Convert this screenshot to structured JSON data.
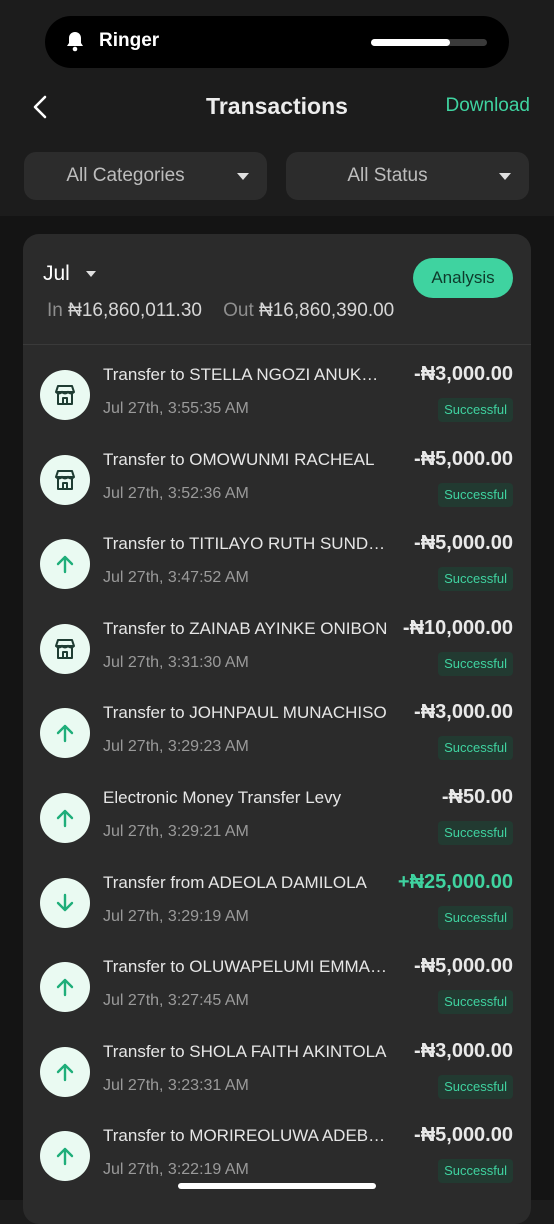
{
  "status_pill": {
    "label": "Ringer",
    "volume_fraction": 0.68
  },
  "header": {
    "title": "Transactions",
    "action_label": "Download"
  },
  "filters": {
    "category": "All Categories",
    "status": "All Status"
  },
  "summary": {
    "month": "Jul",
    "in_label": "In",
    "in_value": "₦16,860,011.30",
    "out_label": "Out",
    "out_value": "₦16,860,390.00",
    "analysis_label": "Analysis"
  },
  "transactions": [
    {
      "title": "Transfer to STELLA NGOZI ANUKWU",
      "time": "Jul 27th, 3:55:35 AM",
      "amount": "-₦3,000.00",
      "status": "Successful",
      "icon": "store-icon"
    },
    {
      "title": "Transfer to OMOWUNMI RACHEAL",
      "time": "Jul 27th, 3:52:36 AM",
      "amount": "-₦5,000.00",
      "status": "Successful",
      "icon": "store-icon"
    },
    {
      "title": "Transfer to TITILAYO RUTH SUNDAY",
      "time": "Jul 27th, 3:47:52 AM",
      "amount": "-₦5,000.00",
      "status": "Successful",
      "icon": "arrow-up-icon"
    },
    {
      "title": "Transfer to ZAINAB AYINKE ONIBON",
      "time": "Jul 27th, 3:31:30 AM",
      "amount": "-₦10,000.00",
      "status": "Successful",
      "icon": "store-icon"
    },
    {
      "title": "Transfer to JOHNPAUL MUNACHISO",
      "time": "Jul 27th, 3:29:23 AM",
      "amount": "-₦3,000.00",
      "status": "Successful",
      "icon": "arrow-up-icon"
    },
    {
      "title": "Electronic Money Transfer Levy",
      "time": "Jul 27th, 3:29:21 AM",
      "amount": "-₦50.00",
      "status": "Successful",
      "icon": "arrow-up-icon"
    },
    {
      "title": "Transfer from ADEOLA DAMILOLA",
      "time": "Jul 27th, 3:29:19 AM",
      "amount": "+₦25,000.00",
      "status": "Successful",
      "icon": "arrow-down-icon"
    },
    {
      "title": "Transfer to OLUWAPELUMI EMMANUEL",
      "time": "Jul 27th, 3:27:45 AM",
      "amount": "-₦5,000.00",
      "status": "Successful",
      "icon": "arrow-up-icon"
    },
    {
      "title": "Transfer to SHOLA FAITH AKINTOLA",
      "time": "Jul 27th, 3:23:31 AM",
      "amount": "-₦3,000.00",
      "status": "Successful",
      "icon": "arrow-up-icon"
    },
    {
      "title": "Transfer to MORIREOLUWA ADEBAYO",
      "time": "Jul 27th, 3:22:19 AM",
      "amount": "-₦5,000.00",
      "status": "Successful",
      "icon": "arrow-up-icon"
    }
  ],
  "colors": {
    "accent": "#3fd3a0",
    "background": "#1c1c1c",
    "card": "#2b2b2b"
  }
}
